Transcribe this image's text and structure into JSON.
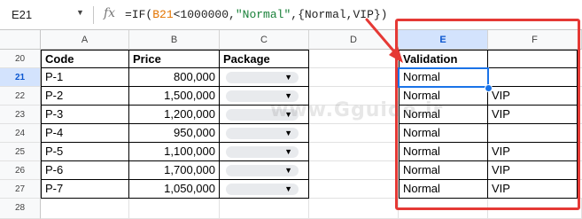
{
  "formula_bar": {
    "cell_ref": "E21",
    "fx": "fx",
    "formula_prefix": "=IF(",
    "formula_ref": "B21",
    "formula_mid": "<1000000,",
    "formula_str": "\"Normal\"",
    "formula_end": ",{Normal,VIP})"
  },
  "columns": [
    "A",
    "B",
    "C",
    "D",
    "E",
    "F"
  ],
  "selected_column": "E",
  "rows": [
    "20",
    "21",
    "22",
    "23",
    "24",
    "25",
    "26",
    "27",
    "28"
  ],
  "selected_row": "21",
  "headers": {
    "code": "Code",
    "price": "Price",
    "package": "Package",
    "validation": "Validation"
  },
  "data_rows": [
    {
      "code": "P-1",
      "price": "800,000",
      "e": "Normal",
      "f": ""
    },
    {
      "code": "P-2",
      "price": "1,500,000",
      "e": "Normal",
      "f": "VIP"
    },
    {
      "code": "P-3",
      "price": "1,200,000",
      "e": "Normal",
      "f": "VIP"
    },
    {
      "code": "P-4",
      "price": "950,000",
      "e": "Normal",
      "f": ""
    },
    {
      "code": "P-5",
      "price": "1,100,000",
      "e": "Normal",
      "f": "VIP"
    },
    {
      "code": "P-6",
      "price": "1,700,000",
      "e": "Normal",
      "f": "VIP"
    },
    {
      "code": "P-7",
      "price": "1,050,000",
      "e": "Normal",
      "f": "VIP"
    }
  ],
  "dropdown_caret": "▼",
  "namebox_caret": "▼",
  "watermark": "www.Gguide.ir",
  "colors": {
    "highlight": "#e53935",
    "selection": "#1a73e8"
  }
}
